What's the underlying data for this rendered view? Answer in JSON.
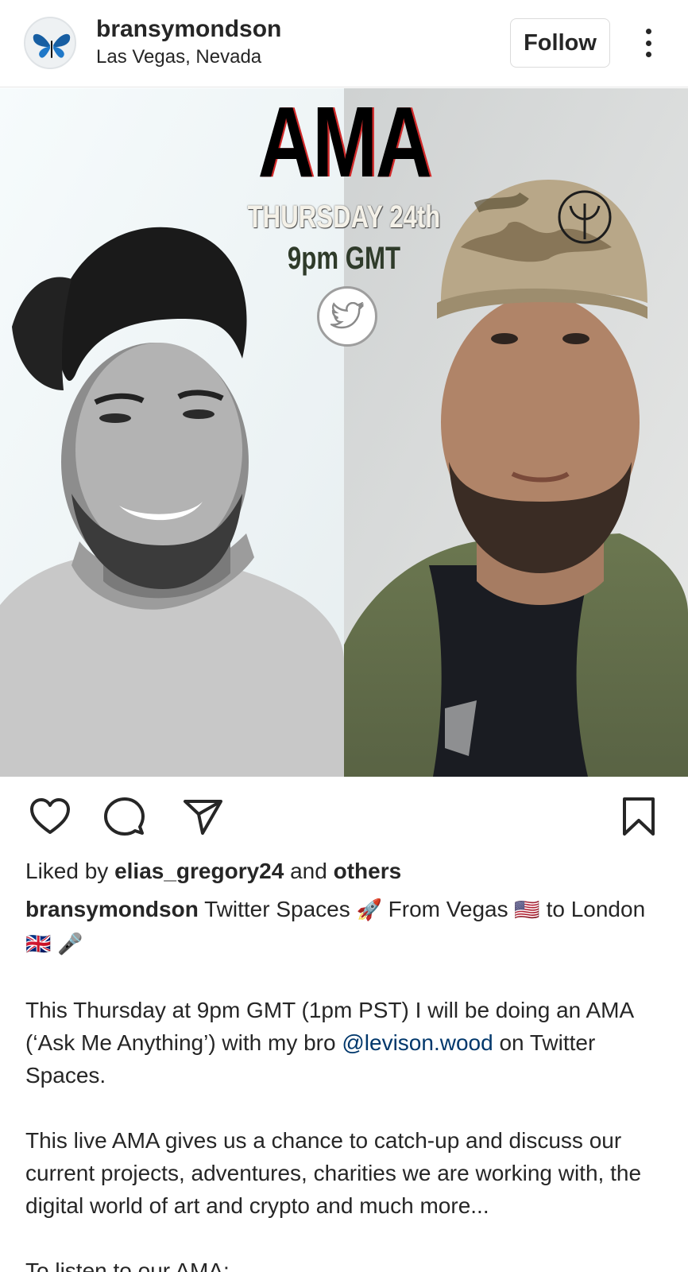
{
  "header": {
    "username": "bransymondson",
    "location": "Las Vegas, Nevada",
    "follow_label": "Follow",
    "avatar_icon": "butterfly-icon",
    "more_icon": "more-vertical-icon"
  },
  "post_image": {
    "title": "AMA",
    "day": "THURSDAY 24th",
    "time": "9pm GMT",
    "badge_icon": "twitter-bird-icon"
  },
  "actions": {
    "like_icon": "heart-icon",
    "comment_icon": "comment-icon",
    "share_icon": "send-icon",
    "save_icon": "bookmark-icon"
  },
  "likes": {
    "prefix": "Liked by",
    "user": "elias_gregory24",
    "middle": "and",
    "others": "others"
  },
  "caption": {
    "username": "bransymondson",
    "line1_a": "Twitter Spaces",
    "line1_emoji_rocket": "🚀",
    "line1_b": "From Vegas",
    "line1_emoji_us": "🇺🇸",
    "line1_c": "to",
    "line2_a": "London",
    "line2_emoji_uk": "🇬🇧",
    "line2_emoji_mic": "🎤",
    "para1_a": "This Thursday at 9pm GMT (1pm PST) I will be doing an AMA (‘Ask Me Anything’) with my bro",
    "para1_mention": "@levison.wood",
    "para1_b": "on Twitter Spaces.",
    "para2": "This live AMA gives us a chance to catch-up and discuss our current projects, adventures, charities we are working with, the digital world of art and crypto and much more...",
    "para3": "To listen to our AMA:"
  },
  "colors": {
    "text": "#262626",
    "mention": "#00376b",
    "border": "#dbdbdb"
  }
}
